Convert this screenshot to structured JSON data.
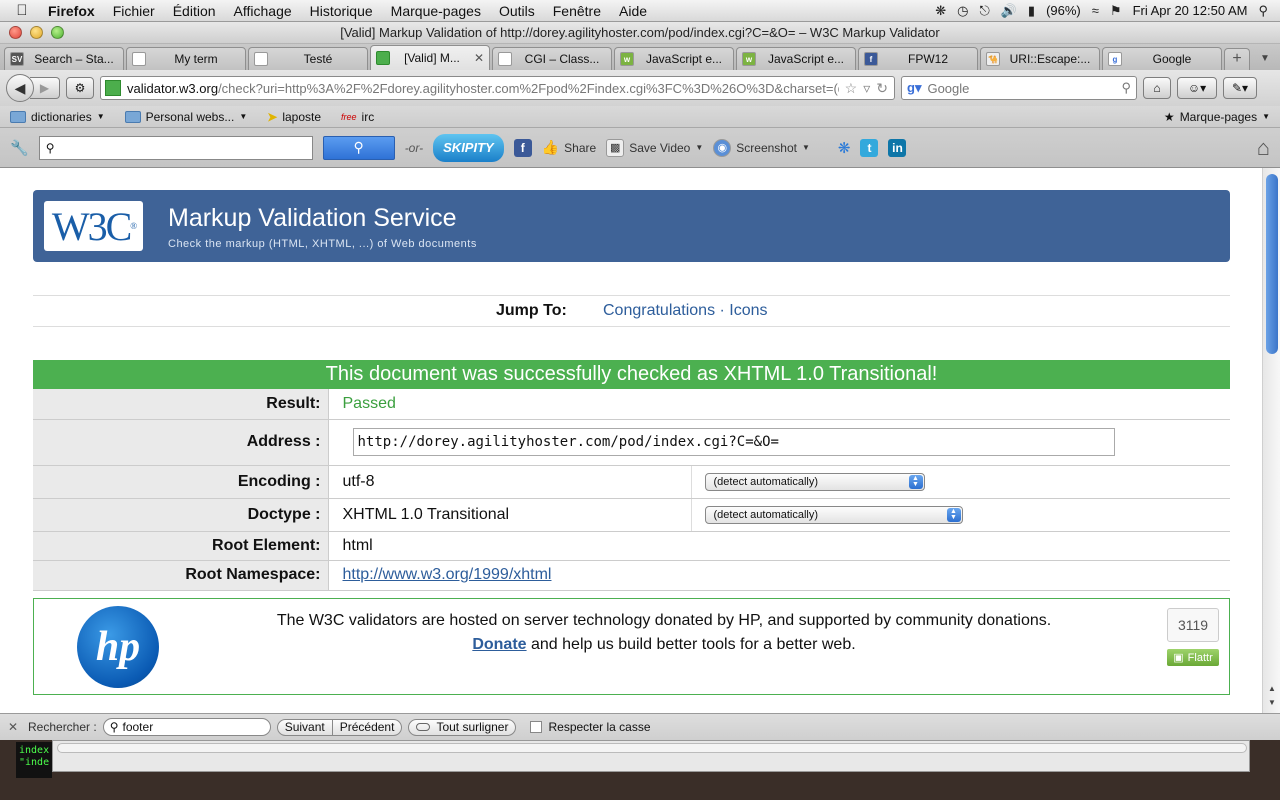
{
  "menubar": {
    "app": "Firefox",
    "items": [
      "Fichier",
      "Édition",
      "Affichage",
      "Historique",
      "Marque-pages",
      "Outils",
      "Fenêtre",
      "Aide"
    ],
    "battery": "(96%)",
    "clock": "Fri Apr 20  12:50 AM"
  },
  "window": {
    "title": "[Valid] Markup Validation of http://dorey.agilityhoster.com/pod/index.cgi?C=&O= – W3C Markup Validator"
  },
  "tabs": [
    {
      "label": "Search – Sta...",
      "fav": "SV"
    },
    {
      "label": "My term",
      "fav": ""
    },
    {
      "label": "Testé",
      "fav": ""
    },
    {
      "label": "[Valid] M...",
      "fav": "",
      "active": true
    },
    {
      "label": "CGI – Class...",
      "fav": ""
    },
    {
      "label": "JavaScript e...",
      "fav": "w"
    },
    {
      "label": "JavaScript e...",
      "fav": "w"
    },
    {
      "label": "FPW12",
      "fav": "f"
    },
    {
      "label": "URI::Escape:...",
      "fav": ""
    },
    {
      "label": "Google",
      "fav": "g"
    }
  ],
  "navbar": {
    "url_domain": "validator.w3.org",
    "url_rest": "/check?uri=http%3A%2F%2Fdorey.agilityhoster.com%2Fpod%2Findex.cgi%3FC%3D%26O%3D&charset=(d",
    "search_placeholder": "Google"
  },
  "bookmarks": [
    {
      "label": "dictionaries",
      "type": "folder"
    },
    {
      "label": "Personal webs...",
      "type": "folder"
    },
    {
      "label": "laposte",
      "type": "link"
    },
    {
      "label": "irc",
      "type": "link"
    }
  ],
  "bookmarks_right": "Marque-pages",
  "addonbar": {
    "or": "-or-",
    "skipity": "SKIPITY",
    "share": "Share",
    "save_video": "Save Video",
    "screenshot": "Screenshot"
  },
  "page": {
    "header_title": "Markup Validation Service",
    "header_subtitle": "Check the markup (HTML, XHTML, ...) of Web documents",
    "logo_text": "W3C",
    "jump_label": "Jump To:",
    "jump_links": [
      "Congratulations",
      "Icons"
    ],
    "jump_sep": " · ",
    "congrats": "This document was successfully checked as XHTML 1.0 Transitional!",
    "result_label": "Result:",
    "result_value": "Passed",
    "address_label": "Address :",
    "address_value": "http://dorey.agilityhoster.com/pod/index.cgi?C=&O=",
    "encoding_label": "Encoding :",
    "encoding_value": "utf-8",
    "encoding_select": "(detect automatically)",
    "doctype_label": "Doctype :",
    "doctype_value": "XHTML 1.0 Transitional",
    "doctype_select": "(detect automatically)",
    "root_element_label": "Root Element:",
    "root_element_value": "html",
    "root_ns_label": "Root Namespace:",
    "root_ns_value": "http://www.w3.org/1999/xhtml",
    "sponsor_line1": "The W3C validators are hosted on server technology donated by HP, and supported by community donations.",
    "sponsor_donate": "Donate",
    "sponsor_line2_rest": " and help us build better tools for a better web.",
    "hp_logo": "hp",
    "flattr_count": "3119",
    "flattr_label": "Flattr"
  },
  "findbar": {
    "label": "Rechercher :",
    "value": "footer",
    "next": "Suivant",
    "prev": "Précédent",
    "highlight": "Tout surligner",
    "match_case": "Respecter la casse"
  },
  "terminal": {
    "text": "index\n\"inde"
  }
}
